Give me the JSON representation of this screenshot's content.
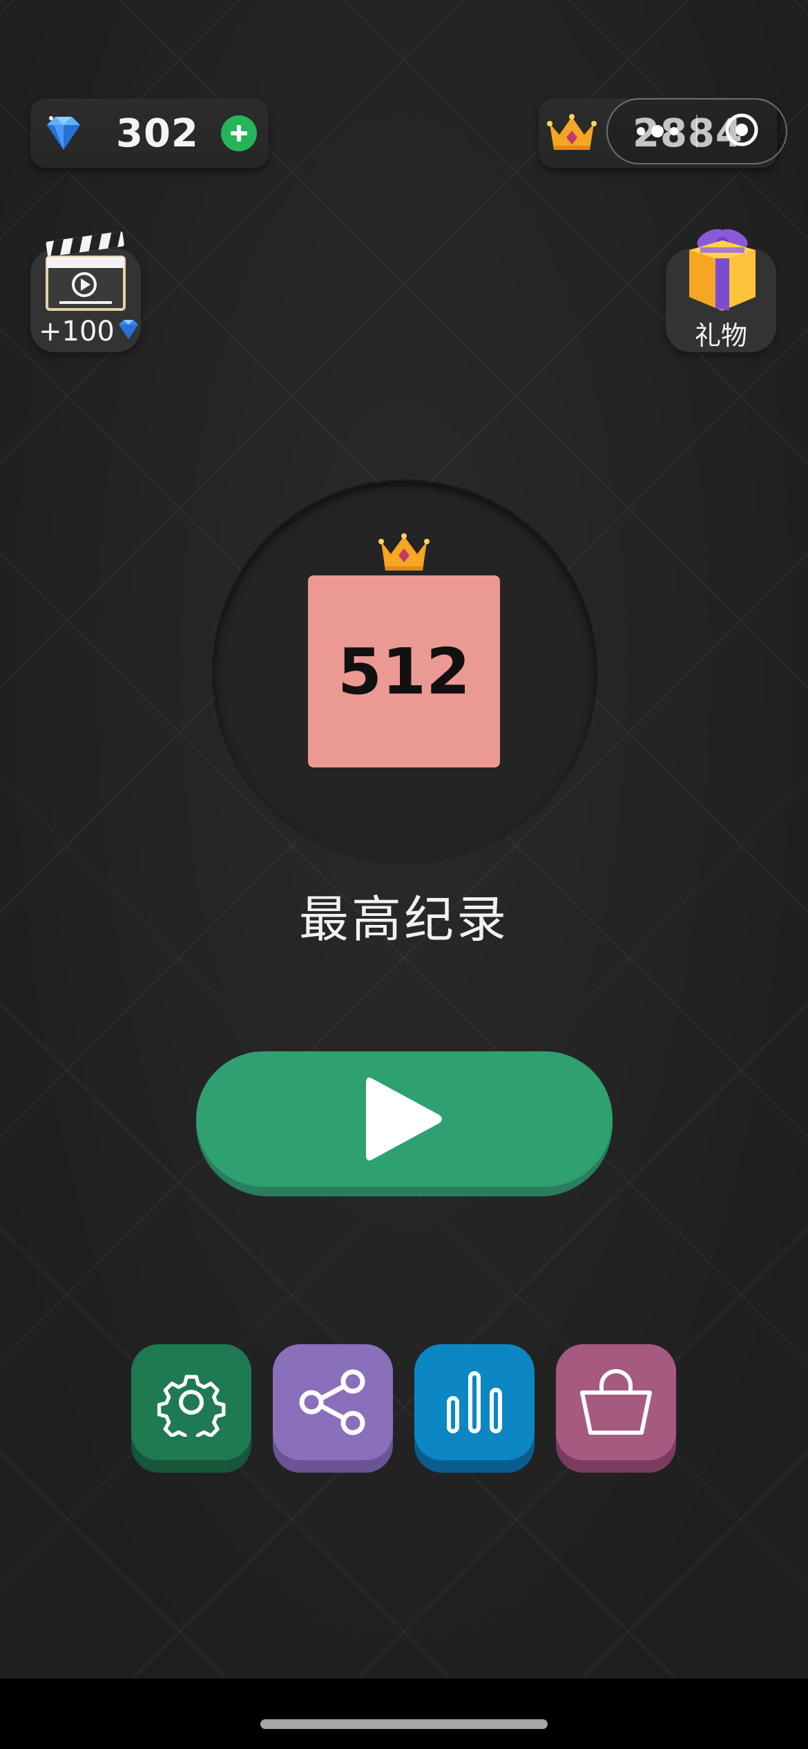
{
  "header": {
    "gems": "302",
    "best": "2884"
  },
  "side": {
    "video_reward": "+100",
    "gift_label": "礼物"
  },
  "record": {
    "tile_value": "512",
    "label": "最高纪录"
  },
  "colors": {
    "tile": "#eb9a93",
    "play": "#2fa070",
    "settings": "#1f7a52",
    "share": "#8a70bb",
    "rank": "#0d86c4",
    "shop": "#a65a80",
    "plus": "#27b35a"
  },
  "icons": {
    "gem": "gem-icon",
    "crown": "crown-icon",
    "plus": "plus-icon",
    "video": "clapperboard-icon",
    "gift": "gift-icon",
    "play": "play-icon",
    "settings": "gear-icon",
    "share": "share-icon",
    "rank": "bar-chart-icon",
    "shop": "shopping-bag-icon"
  }
}
